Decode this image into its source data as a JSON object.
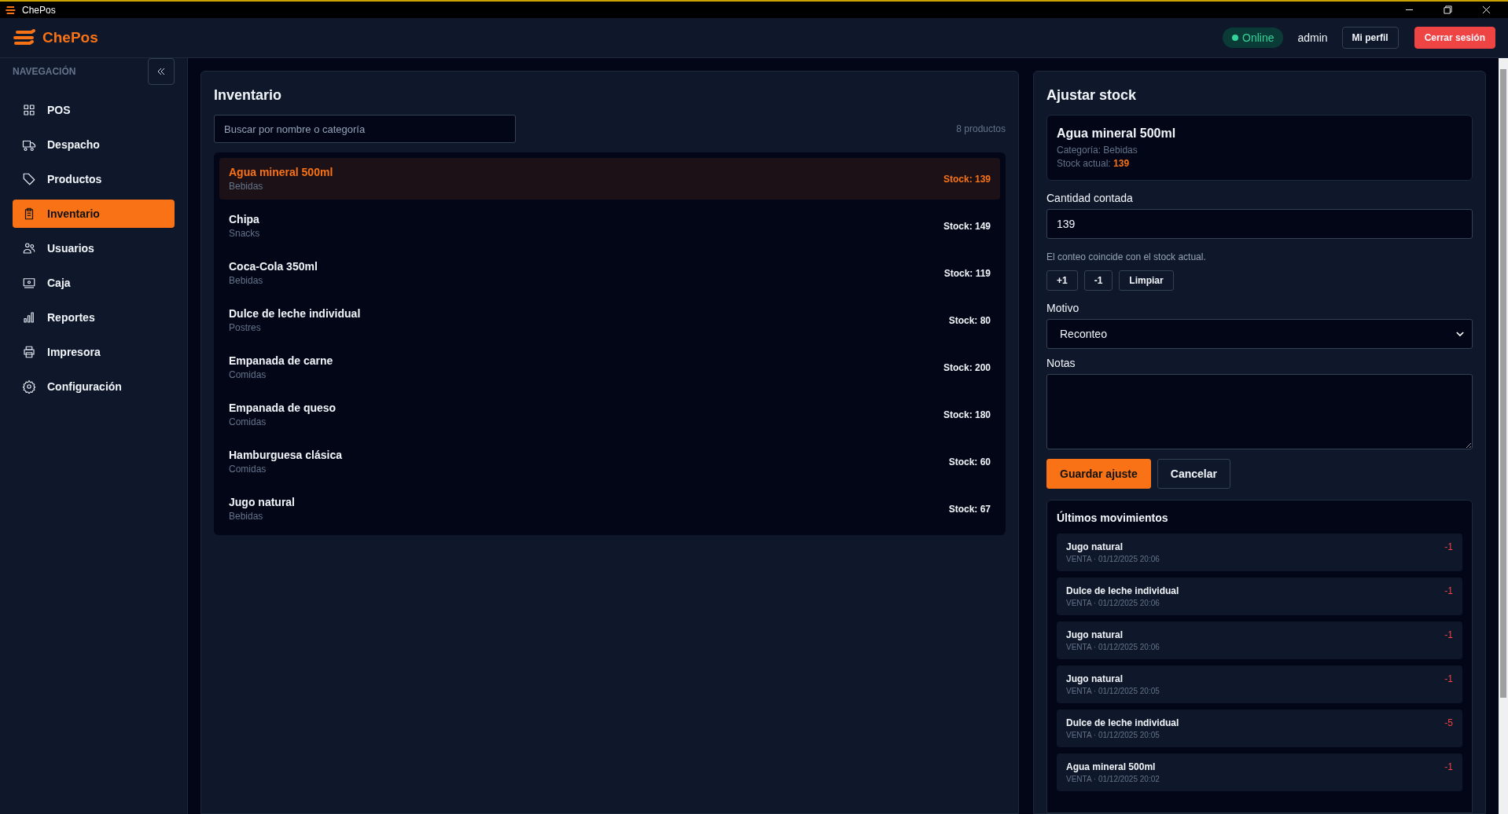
{
  "window": {
    "title": "ChePos"
  },
  "header": {
    "brand": "ChePos",
    "status": {
      "label": "Online",
      "online": true
    },
    "user": "admin",
    "profile_button": "Mi perfil",
    "logout_button": "Cerrar sesión"
  },
  "sidebar": {
    "heading": "NAVEGACIÓN",
    "items": [
      {
        "label": "POS",
        "selected": false
      },
      {
        "label": "Despacho",
        "selected": false
      },
      {
        "label": "Productos",
        "selected": false
      },
      {
        "label": "Inventario",
        "selected": true
      },
      {
        "label": "Usuarios",
        "selected": false
      },
      {
        "label": "Caja",
        "selected": false
      },
      {
        "label": "Reportes",
        "selected": false
      },
      {
        "label": "Impresora",
        "selected": false
      },
      {
        "label": "Configuración",
        "selected": false
      }
    ]
  },
  "inventory": {
    "title": "Inventario",
    "search": {
      "placeholder": "Buscar por nombre o categoría"
    },
    "count": "8 productos",
    "products": [
      {
        "name": "Agua mineral 500ml",
        "category": "Bebidas",
        "stock": "Stock: 139",
        "selected": true
      },
      {
        "name": "Chipa",
        "category": "Snacks",
        "stock": "Stock: 149",
        "selected": false
      },
      {
        "name": "Coca-Cola 350ml",
        "category": "Bebidas",
        "stock": "Stock: 119",
        "selected": false
      },
      {
        "name": "Dulce de leche individual",
        "category": "Postres",
        "stock": "Stock: 80",
        "selected": false
      },
      {
        "name": "Empanada de carne",
        "category": "Comidas",
        "stock": "Stock: 200",
        "selected": false
      },
      {
        "name": "Empanada de queso",
        "category": "Comidas",
        "stock": "Stock: 180",
        "selected": false
      },
      {
        "name": "Hamburguesa clásica",
        "category": "Comidas",
        "stock": "Stock: 60",
        "selected": false
      },
      {
        "name": "Jugo natural",
        "category": "Bebidas",
        "stock": "Stock: 67",
        "selected": false
      }
    ]
  },
  "adjust": {
    "title": "Ajustar stock",
    "product": {
      "name": "Agua mineral 500ml",
      "category": "Categoría: Bebidas",
      "stock": "Stock actual: **139**"
    },
    "counted_label": "Cantidad contada",
    "counted_value": "139",
    "hint": "El conteo coincide con el stock actual.",
    "quick_buttons": [
      "+1",
      "-1",
      "Limpiar"
    ],
    "reason_label": "Motivo",
    "reason_value": "Reconteo",
    "notes_label": "Notas",
    "save_button": "Guardar ajuste",
    "cancel_button": "Cancelar"
  },
  "movements": {
    "title": "Últimos movimientos",
    "items": [
      {
        "product": "Jugo natural",
        "meta": "VENTA · 01/12/2025 20:06",
        "delta": "-1"
      },
      {
        "product": "Dulce de leche individual",
        "meta": "VENTA · 01/12/2025 20:06",
        "delta": "-1"
      },
      {
        "product": "Jugo natural",
        "meta": "VENTA · 01/12/2025 20:06",
        "delta": "-1"
      },
      {
        "product": "Jugo natural",
        "meta": "VENTA · 01/12/2025 20:05",
        "delta": "-1"
      },
      {
        "product": "Dulce de leche individual",
        "meta": "VENTA · 01/12/2025 20:05",
        "delta": "-5"
      },
      {
        "product": "Agua mineral 500ml",
        "meta": "VENTA · 01/12/2025 20:02",
        "delta": "-1"
      }
    ]
  }
}
